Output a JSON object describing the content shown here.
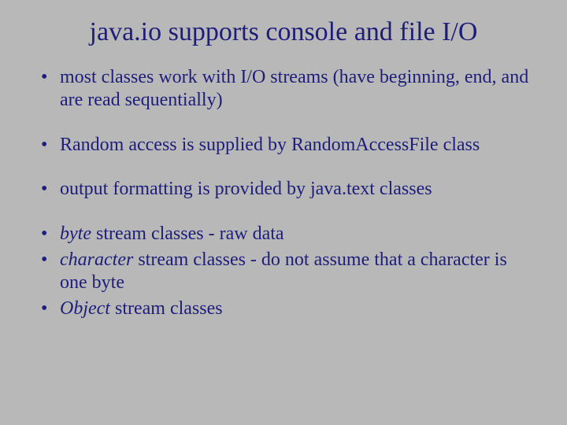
{
  "title": "java.io supports console and file I/O",
  "bullets": {
    "b0": "most classes work with I/O streams  (have beginning, end, and are read sequentially)",
    "b1": "Random access is supplied by RandomAccessFile class",
    "b2": "output formatting is provided by java.text classes",
    "b3_italic": "byte",
    "b3_rest": " stream classes - raw data",
    "b4_italic": "character",
    "b4_rest": "  stream classes - do not assume that a character is one byte",
    "b5_italic": "Object",
    "b5_rest": " stream classes"
  }
}
